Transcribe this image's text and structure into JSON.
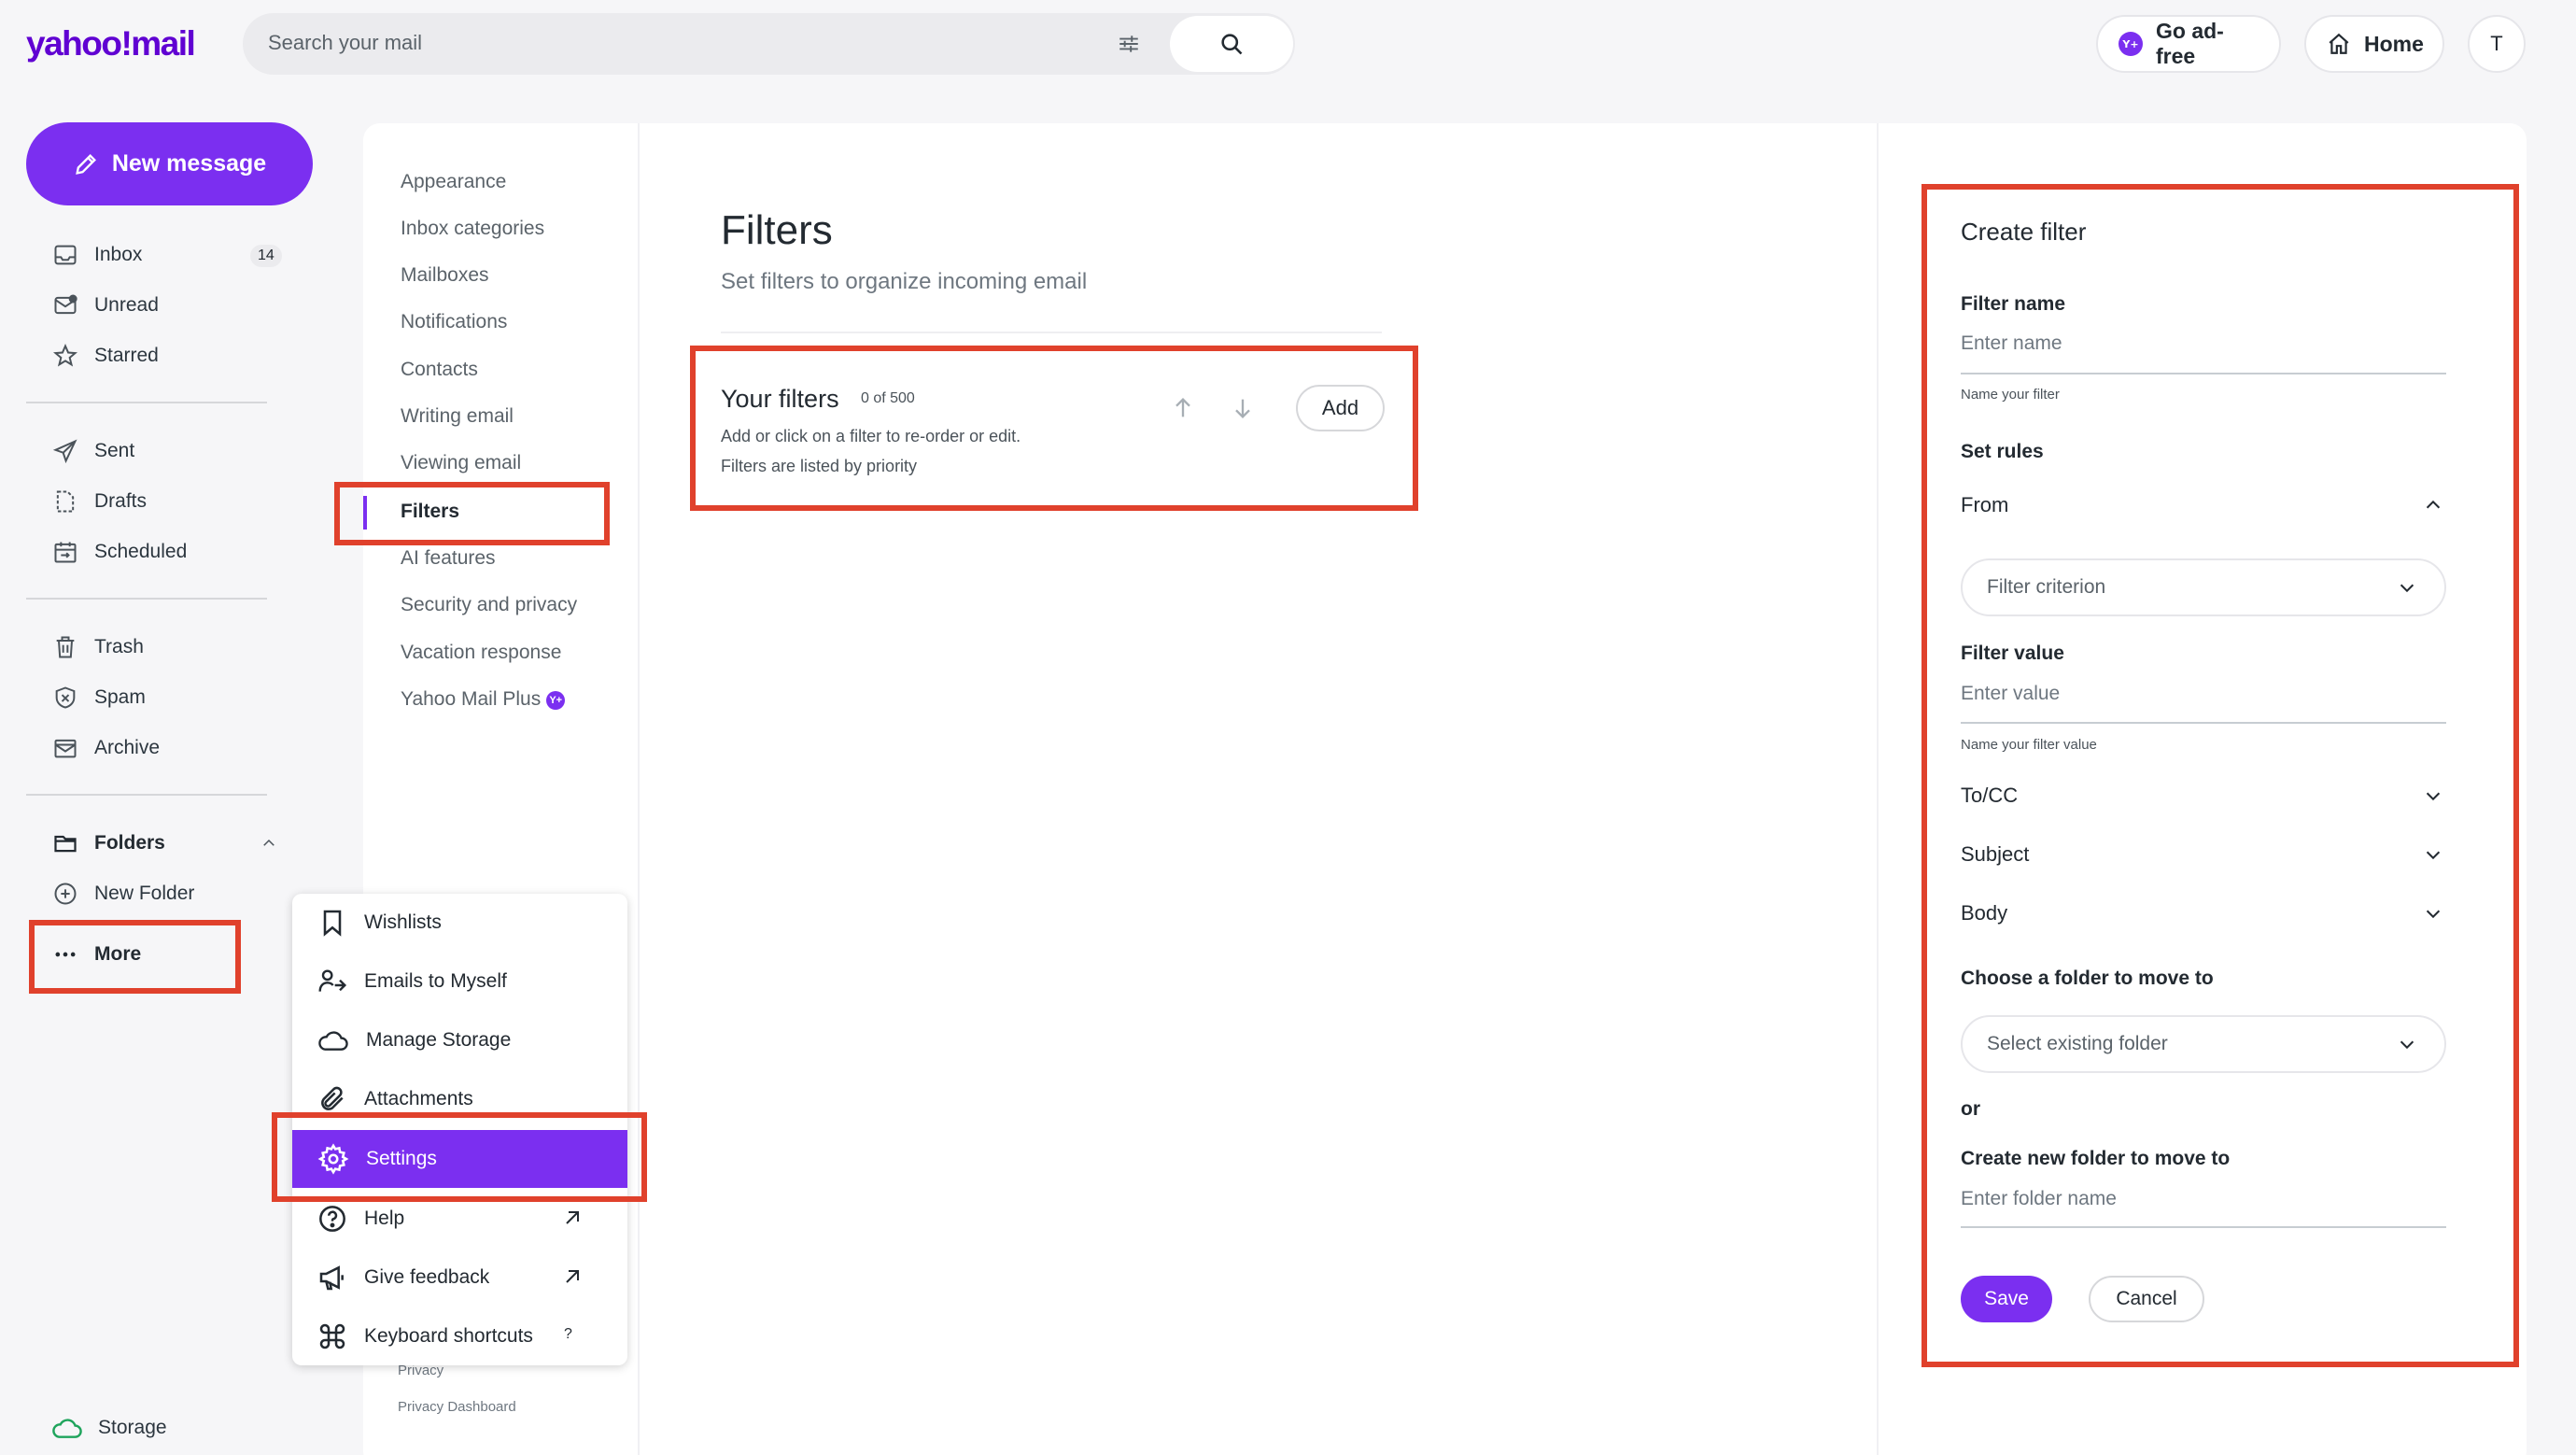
{
  "header": {
    "logo": "yahoo!mail",
    "search_placeholder": "Search your mail",
    "ad_free_label": "Go ad-free",
    "home_label": "Home",
    "avatar_initial": "T"
  },
  "nav": {
    "new_message": "New message",
    "inbox": "Inbox",
    "inbox_count": "14",
    "unread": "Unread",
    "starred": "Starred",
    "sent": "Sent",
    "drafts": "Drafts",
    "scheduled": "Scheduled",
    "trash": "Trash",
    "spam": "Spam",
    "archive": "Archive",
    "folders": "Folders",
    "new_folder": "New Folder",
    "more": "More",
    "storage": "Storage"
  },
  "settings_nav": {
    "items": [
      "Appearance",
      "Inbox categories",
      "Mailboxes",
      "Notifications",
      "Contacts",
      "Writing email",
      "Viewing email",
      "Filters",
      "AI features",
      "Security and privacy",
      "Vacation response",
      "Yahoo Mail Plus"
    ],
    "active": "Filters"
  },
  "filters": {
    "title": "Filters",
    "subtitle": "Set filters to organize incoming email",
    "your_filters": "Your filters",
    "count": "0 of 500",
    "desc1": "Add or click on a filter to re-order or edit.",
    "desc2": "Filters are listed by priority",
    "add": "Add"
  },
  "create_filter": {
    "title": "Create filter",
    "filter_name_label": "Filter name",
    "filter_name_placeholder": "Enter name",
    "filter_name_help": "Name your filter",
    "set_rules": "Set rules",
    "from": "From",
    "filter_criterion": "Filter criterion",
    "filter_value_label": "Filter value",
    "filter_value_placeholder": "Enter value",
    "filter_value_help": "Name your filter value",
    "to_cc": "To/CC",
    "subject": "Subject",
    "body": "Body",
    "choose_folder": "Choose a folder to move to",
    "select_folder": "Select existing folder",
    "or": "or",
    "create_folder": "Create new folder to move to",
    "folder_placeholder": "Enter folder name",
    "save": "Save",
    "cancel": "Cancel"
  },
  "more_menu": {
    "wishlists": "Wishlists",
    "emails_to_myself": "Emails to Myself",
    "manage_storage": "Manage Storage",
    "attachments": "Attachments",
    "settings": "Settings",
    "help": "Help",
    "give_feedback": "Give feedback",
    "keyboard_shortcuts": "Keyboard shortcuts",
    "shortcut_key": "?"
  },
  "footer": {
    "privacy": "Privacy",
    "privacy_dashboard": "Privacy Dashboard"
  },
  "colors": {
    "accent": "#7b2ff0",
    "annotation": "#e0412c",
    "storage_icon": "#1fa45c"
  }
}
